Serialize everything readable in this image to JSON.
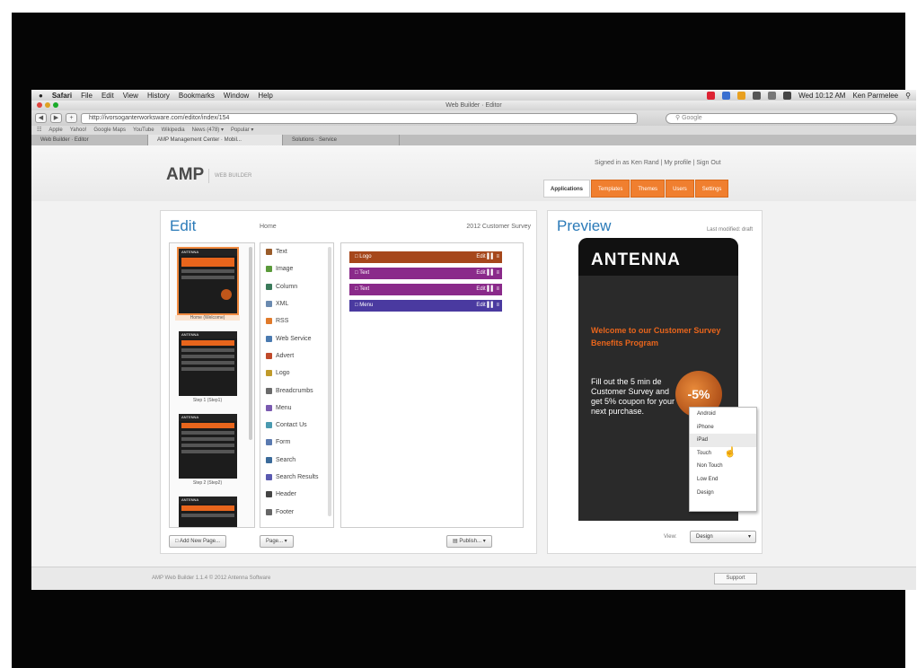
{
  "menubar": {
    "apple": "",
    "items": [
      "Safari",
      "File",
      "Edit",
      "View",
      "History",
      "Bookmarks",
      "Window",
      "Help"
    ],
    "clock": "Wed 10:12 AM",
    "user": "Ken Parmelee"
  },
  "window": {
    "title": "Web Builder · Editor"
  },
  "toolbar": {
    "url": "http://ivorsoganterworksware.com/editor/index/154",
    "search_placeholder": "Google"
  },
  "bookmarks": [
    "Apple",
    "Yahoo!",
    "Google Maps",
    "YouTube",
    "Wikipedia",
    "News (478) ▾",
    "Popular ▾"
  ],
  "tabs": [
    "Web Builder · Editor",
    "AMP Management Center · Mobil...",
    "Solutions · Service"
  ],
  "header": {
    "logo": "AMP",
    "logo_sub": "WEB BUILDER",
    "signed_in": "Signed in as Ken Rand  |  My profile  |  Sign Out",
    "nav": [
      "Applications",
      "Templates",
      "Themes",
      "Users",
      "Settings"
    ]
  },
  "edit": {
    "title": "Edit",
    "home": "Home",
    "survey": "2012 Customer Survey",
    "pages": [
      {
        "label": "Home (Welcome)"
      },
      {
        "label": "Step 1 (Step1)"
      },
      {
        "label": "Step 2 (Step2)"
      },
      {
        "label": ""
      }
    ],
    "widgets": [
      {
        "label": "Text",
        "color": "#9a5c2a"
      },
      {
        "label": "Image",
        "color": "#5a9a3a"
      },
      {
        "label": "Column",
        "color": "#3a7a5a"
      },
      {
        "label": "XML",
        "color": "#6a8ab0"
      },
      {
        "label": "RSS",
        "color": "#e07a2a"
      },
      {
        "label": "Web Service",
        "color": "#4a7ab0"
      },
      {
        "label": "Advert",
        "color": "#c04a2a"
      },
      {
        "label": "Logo",
        "color": "#c09a2a"
      },
      {
        "label": "Breadcrumbs",
        "color": "#6a6a6a"
      },
      {
        "label": "Menu",
        "color": "#7a5ab0"
      },
      {
        "label": "Contact Us",
        "color": "#4a9ab0"
      },
      {
        "label": "Form",
        "color": "#5a7ab0"
      },
      {
        "label": "Search",
        "color": "#3a6a9a"
      },
      {
        "label": "Search Results",
        "color": "#5a5ab0"
      },
      {
        "label": "Header",
        "color": "#444444"
      },
      {
        "label": "Footer",
        "color": "#666666"
      }
    ],
    "blocks": [
      {
        "label": "Logo",
        "color": "#a6471b",
        "tools": "Edit ▌▌ ≡"
      },
      {
        "label": "Text",
        "color": "#8a2a8a",
        "tools": "Edit ▌▌ ≡"
      },
      {
        "label": "Text",
        "color": "#8a2a8a",
        "tools": "Edit ▌▌ ≡"
      },
      {
        "label": "Menu",
        "color": "#4a3aa0",
        "tools": "Edit ▌▌ ≡"
      }
    ],
    "add_page": "Add New Page...",
    "page_menu": "Page... ▾",
    "publish": "Publish...  ▾"
  },
  "preview": {
    "title": "Preview",
    "status": "Last modified: draft",
    "brand": "ANTENNA",
    "brand_sub": "",
    "welcome": "Welcome to our Customer Survey Benefits Program",
    "body": "Fill out the 5 min de Customer Survey and get 5% coupon for your next purchase.",
    "discount": "-5%",
    "view_label": "View:",
    "view_value": "Design",
    "dropdown": [
      "Android",
      "iPhone",
      "iPad",
      "Touch",
      "Non Touch",
      "Low End",
      "Design"
    ],
    "highlighted": "iPad"
  },
  "footer": {
    "text": "AMP Web Builder 1.1.4 © 2012 Antenna Software",
    "support": "Support"
  },
  "colors": {
    "accent": "#f07f2f",
    "link": "#2a7ab8"
  }
}
